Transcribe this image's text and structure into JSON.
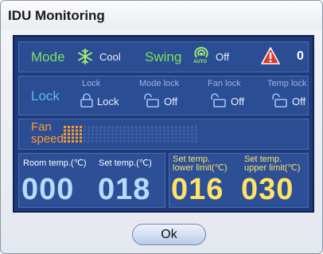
{
  "window": {
    "title": "IDU Monitoring"
  },
  "mode_row": {
    "mode_label": "Mode",
    "mode_value": "Cool",
    "mode_icon": "snowflake-icon",
    "swing_label": "Swing",
    "swing_value": "Off",
    "swing_icon": "auto-swing-icon",
    "swing_icon_text": "AUTO",
    "alarm_icon": "warning-icon",
    "alarm_count": "0"
  },
  "lock_row": {
    "label": "Lock",
    "items": [
      {
        "header": "Lock",
        "value": "Lock",
        "icon": "lock-icon"
      },
      {
        "header": "Mode lock",
        "value": "Off",
        "icon": "unlock-icon"
      },
      {
        "header": "Fan lock",
        "value": "Off",
        "icon": "unlock-icon"
      },
      {
        "header": "Temp lock",
        "value": "Off",
        "icon": "unlock-icon"
      }
    ]
  },
  "fan_row": {
    "label_line1": "Fan",
    "label_line2": "speed",
    "level_fraction": 0.15
  },
  "temps": {
    "room_label": "Room temp.(℃)",
    "room_value": "000",
    "set_label": "Set temp.(℃)",
    "set_value": "018",
    "lower_label_1": "Set temp.",
    "lower_label_2": "lower limit(℃)",
    "lower_value": "016",
    "upper_label_1": "Set temp.",
    "upper_label_2": "upper limit(℃)",
    "upper_value": "030"
  },
  "buttons": {
    "ok_label": "Ok"
  },
  "colors": {
    "panel_bg": "#1f3a78",
    "label_green": "#7ee05a",
    "label_blue": "#5db8ee",
    "label_orange": "#ff9a2e",
    "limit_yellow": "#ffe266",
    "alarm_red": "#e03a2a"
  }
}
